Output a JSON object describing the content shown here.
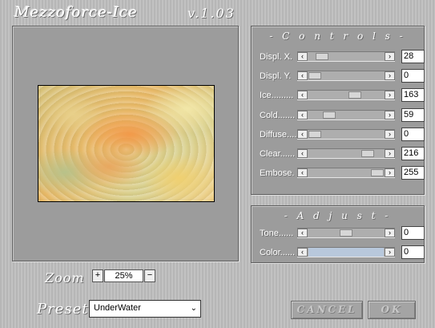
{
  "app": {
    "title": "Mezzoforce-Ice",
    "version": "v.1.03"
  },
  "controls": {
    "title": "- C o n t r o l s -",
    "sliders": [
      {
        "label": "Displ. X.",
        "value": "28",
        "level": 0.11
      },
      {
        "label": "Displ. Y.",
        "value": "0",
        "level": 0.0
      },
      {
        "label": "Ice.........",
        "value": "163",
        "level": 0.64
      },
      {
        "label": "Cold.......",
        "value": "59",
        "level": 0.23
      },
      {
        "label": "Diffuse....",
        "value": "0",
        "level": 0.0
      },
      {
        "label": "Clear......",
        "value": "216",
        "level": 0.85
      },
      {
        "label": "Embose.",
        "value": "255",
        "level": 1.0
      }
    ]
  },
  "adjust": {
    "title": "- A d j u s t -",
    "sliders": [
      {
        "label": "Tone......",
        "value": "0",
        "level": 0.5
      },
      {
        "label": "Color......",
        "value": "0",
        "level": 0.0
      }
    ]
  },
  "zoom": {
    "label": "Zoom",
    "value": "25%",
    "plus": "+",
    "minus": "−"
  },
  "preset": {
    "label": "Preset",
    "selected": "UnderWater"
  },
  "buttons": {
    "cancel": "CANCEL",
    "ok": "OK"
  }
}
